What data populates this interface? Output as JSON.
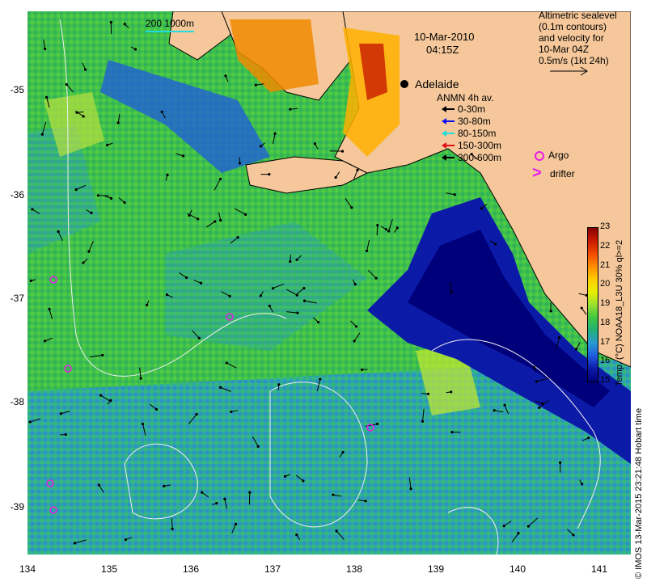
{
  "map": {
    "title_date": "10-Mar-2010",
    "title_time": "04:15Z",
    "city_label": "Adelaide",
    "scale_label": "200  1000m"
  },
  "axes": {
    "y_ticks": [
      "-35",
      "-36",
      "-37",
      "-38",
      "-39"
    ],
    "x_ticks": [
      "134",
      "135",
      "136",
      "137",
      "138",
      "139",
      "140",
      "141"
    ]
  },
  "legend": {
    "header_lines": [
      "Altimetric sealevel",
      "(0.1m contours)",
      "and velocity for",
      "10-Mar 04Z",
      "0.5m/s (1kt 24h)"
    ],
    "anmn_title": "ANMN 4h av.",
    "depths": [
      {
        "label": "0-30m",
        "color": "#000000"
      },
      {
        "label": "30-80m",
        "color": "#1010ee"
      },
      {
        "label": "80-150m",
        "color": "#22dddd"
      },
      {
        "label": "150-300m",
        "color": "#dd1111"
      },
      {
        "label": "300-600m",
        "color": "#000000"
      }
    ],
    "argo_label": "Argo",
    "drifter_label": "drifter",
    "argo_color": "#e81ce8"
  },
  "colorbar": {
    "label": "Temp. (°C) NOAA18_L3U 30% ql>=2",
    "ticks": [
      "23",
      "22",
      "21",
      "20",
      "19",
      "18",
      "17",
      "16",
      "15"
    ],
    "colors": [
      "#8a0000",
      "#c81a00",
      "#f04a00",
      "#ff8c00",
      "#ffcc00",
      "#e8f000",
      "#9ae030",
      "#3ec840",
      "#22b07a",
      "#2a9ad0",
      "#1f5ae0",
      "#0c1aa8",
      "#00007a"
    ]
  },
  "credit": "© IMOS 13-Mar-2015 23:21:48 Hobart time"
}
